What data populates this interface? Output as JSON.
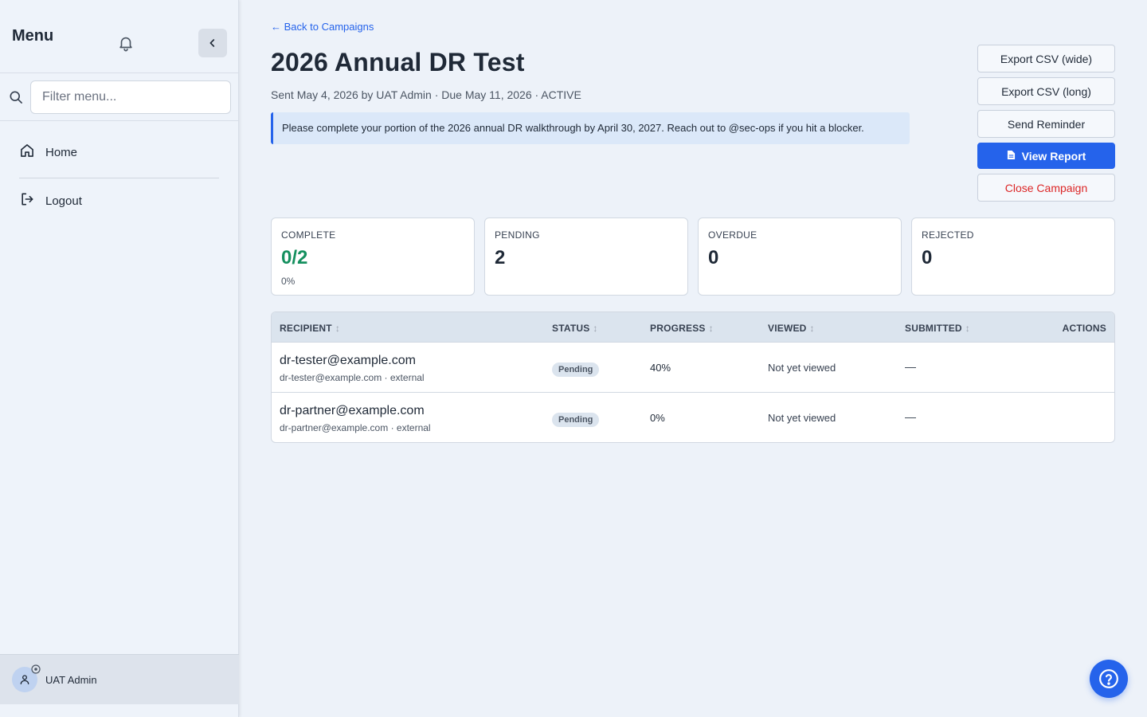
{
  "sidebar": {
    "title": "Menu",
    "search_placeholder": "Filter menu...",
    "items": [
      {
        "label": "Home",
        "icon": "home-icon"
      },
      {
        "label": "Logout",
        "icon": "logout-icon"
      }
    ],
    "user": {
      "name": "UAT Admin"
    }
  },
  "main": {
    "back_link": "← Back to Campaigns",
    "title": "2026 Annual DR Test",
    "meta": "Sent May 4, 2026 by UAT Admin · Due May 11, 2026 · ACTIVE",
    "notice": "Please complete your portion of the 2026 annual DR walkthrough by April 30, 2027. Reach out to @sec-ops if you hit a blocker."
  },
  "actions": {
    "export_wide": "Export CSV (wide)",
    "export_long": "Export CSV (long)",
    "send_reminder": "Send Reminder",
    "view_report": "View Report",
    "close_campaign": "Close Campaign"
  },
  "stats": {
    "complete": {
      "label": "COMPLETE",
      "value": "0/2",
      "sub": "0%"
    },
    "pending": {
      "label": "PENDING",
      "value": "2"
    },
    "overdue": {
      "label": "OVERDUE",
      "value": "0"
    },
    "rejected": {
      "label": "REJECTED",
      "value": "0"
    }
  },
  "table": {
    "headers": {
      "recipient": "RECIPIENT",
      "status": "STATUS",
      "progress": "PROGRESS",
      "viewed": "VIEWED",
      "submitted": "SUBMITTED",
      "actions": "ACTIONS"
    },
    "rows": [
      {
        "name": "dr-tester@example.com",
        "sub": "dr-tester@example.com · external",
        "status": "Pending",
        "progress": "40%",
        "viewed": "Not yet viewed",
        "submitted": "—"
      },
      {
        "name": "dr-partner@example.com",
        "sub": "dr-partner@example.com · external",
        "status": "Pending",
        "progress": "0%",
        "viewed": "Not yet viewed",
        "submitted": "—"
      }
    ]
  },
  "colors": {
    "accent": "#2563eb",
    "success": "#15905f",
    "danger": "#dc2626"
  }
}
